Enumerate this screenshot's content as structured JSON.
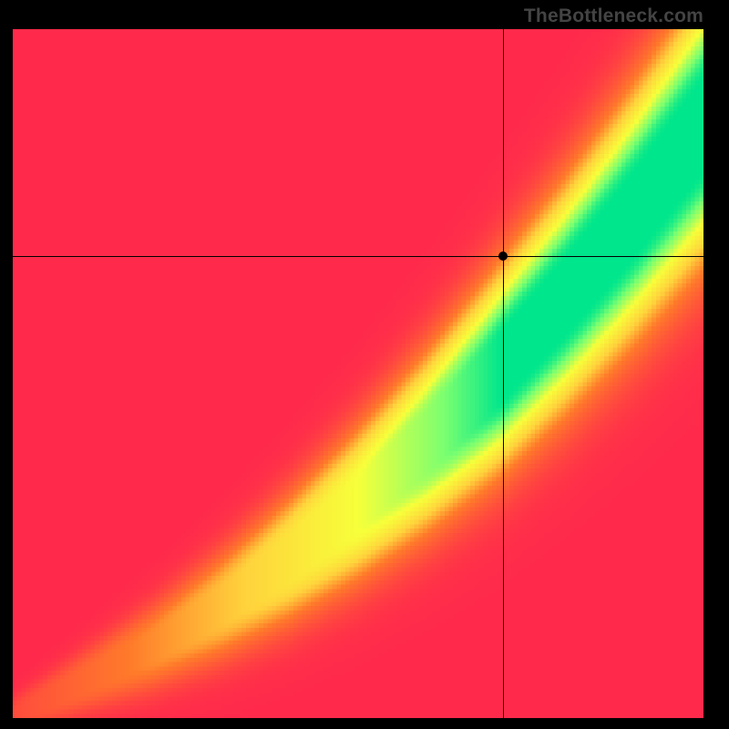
{
  "watermark": "TheBottleneck.com",
  "chart_data": {
    "type": "heatmap",
    "title": "",
    "xlabel": "",
    "ylabel": "",
    "xlim": [
      0,
      100
    ],
    "ylim": [
      0,
      100
    ],
    "x_axis_shown": false,
    "y_axis_shown": false,
    "grid": false,
    "colormap": "red-yellow-green",
    "colormap_stops": [
      {
        "t": 0.0,
        "color": "#ff2a4b"
      },
      {
        "t": 0.35,
        "color": "#ff7a2a"
      },
      {
        "t": 0.55,
        "color": "#ffd23c"
      },
      {
        "t": 0.75,
        "color": "#f7ff3a"
      },
      {
        "t": 0.9,
        "color": "#7bff70"
      },
      {
        "t": 1.0,
        "color": "#00e68c"
      }
    ],
    "optimal_curve": {
      "description": "Green ridge where y ≈ f(x); slightly convex, steeper toward upper-right",
      "points": [
        {
          "x": 0,
          "y": 0
        },
        {
          "x": 10,
          "y": 5
        },
        {
          "x": 20,
          "y": 10
        },
        {
          "x": 30,
          "y": 16
        },
        {
          "x": 40,
          "y": 23
        },
        {
          "x": 50,
          "y": 31
        },
        {
          "x": 60,
          "y": 40
        },
        {
          "x": 70,
          "y": 50
        },
        {
          "x": 80,
          "y": 61
        },
        {
          "x": 90,
          "y": 73
        },
        {
          "x": 100,
          "y": 86
        }
      ]
    },
    "marker": {
      "x": 71,
      "y": 67
    },
    "crosshair": {
      "x": 71,
      "y": 67
    },
    "heatmap_resolution": 160
  }
}
